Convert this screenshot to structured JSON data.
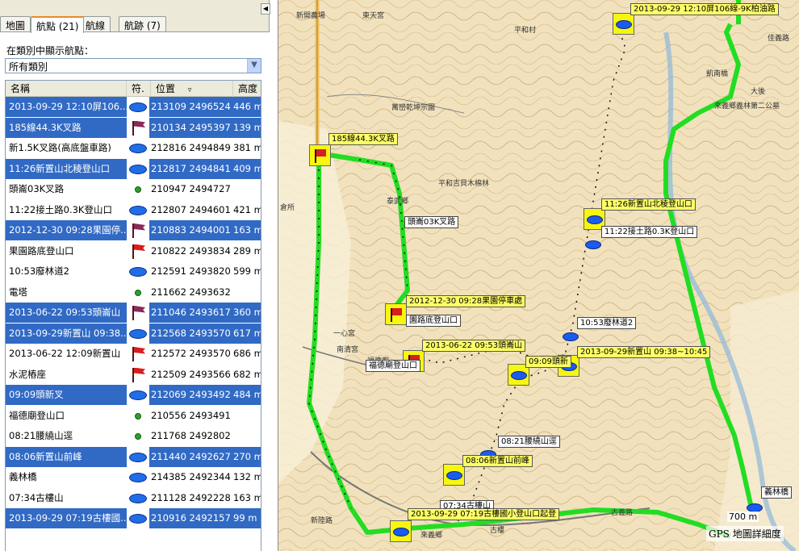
{
  "tabs": [
    {
      "label": "地圖"
    },
    {
      "label": "航點 (21)"
    },
    {
      "label": "航線"
    },
    {
      "label": "航跡 (7)"
    }
  ],
  "filter": {
    "label": "在類別中顯示航點：",
    "selected": "所有類別"
  },
  "table": {
    "headers": {
      "name": "名稱",
      "symbol": "符.",
      "position": "位置",
      "altitude": "高度"
    },
    "rows": [
      {
        "name": "2013-09-29 12:10屏106...",
        "symbol": "ellipse",
        "position": "213109 2496524",
        "altitude": "446 m",
        "selected": true
      },
      {
        "name": "185線44.3K叉路",
        "symbol": "flag-purple",
        "position": "210134 2495397",
        "altitude": "139 m",
        "selected": true
      },
      {
        "name": "新1.5K叉路(高底盤車路)",
        "symbol": "ellipse",
        "position": "212816 2494849",
        "altitude": "381 m",
        "selected": false
      },
      {
        "name": "11:26新置山北稜登山口",
        "symbol": "ellipse",
        "position": "212817 2494841",
        "altitude": "409 m",
        "selected": true
      },
      {
        "name": "頭崙03K叉路",
        "symbol": "dot",
        "position": "210947 2494727",
        "altitude": "",
        "selected": false
      },
      {
        "name": "11:22接土路0.3K登山口",
        "symbol": "ellipse",
        "position": "212807 2494601",
        "altitude": "421 m",
        "selected": false
      },
      {
        "name": "2012-12-30 09:28果園停...",
        "symbol": "flag-purple",
        "position": "210883 2494001",
        "altitude": "163 m",
        "selected": true
      },
      {
        "name": "果園路底登山口",
        "symbol": "flag",
        "position": "210822 2493834",
        "altitude": "289 m",
        "selected": false
      },
      {
        "name": "10:53廢林道2",
        "symbol": "ellipse",
        "position": "212591 2493820",
        "altitude": "599 m",
        "selected": false
      },
      {
        "name": "電塔",
        "symbol": "dot",
        "position": "211662 2493632",
        "altitude": "",
        "selected": false
      },
      {
        "name": "2013-06-22 09:53頭崙山",
        "symbol": "flag-purple",
        "position": "211046 2493617",
        "altitude": "360 m",
        "selected": true
      },
      {
        "name": "2013-09-29新置山 09:38...",
        "symbol": "ellipse",
        "position": "212568 2493570",
        "altitude": "617 m",
        "selected": true
      },
      {
        "name": "2013-06-22 12:09新置山",
        "symbol": "flag",
        "position": "212572 2493570",
        "altitude": "686 m",
        "selected": false
      },
      {
        "name": "水泥樁座",
        "symbol": "flag",
        "position": "212509 2493566",
        "altitude": "682 m",
        "selected": false
      },
      {
        "name": "09:09頭新叉",
        "symbol": "ellipse",
        "position": "212069 2493492",
        "altitude": "484 m",
        "selected": true
      },
      {
        "name": "福德廟登山口",
        "symbol": "dot",
        "position": "210556 2493491",
        "altitude": "",
        "selected": false
      },
      {
        "name": "08:21腰繞山逕",
        "symbol": "dot",
        "position": "211768 2492802",
        "altitude": "",
        "selected": false
      },
      {
        "name": "08:06新置山前峰",
        "symbol": "ellipse",
        "position": "211440 2492627",
        "altitude": "270 m",
        "selected": true
      },
      {
        "name": "義林橋",
        "symbol": "ellipse",
        "position": "214385 2492344",
        "altitude": "132 m",
        "selected": false
      },
      {
        "name": "07:34古樓山",
        "symbol": "ellipse",
        "position": "211128 2492228",
        "altitude": "163 m",
        "selected": false
      },
      {
        "name": "2013-09-29 07:19古樓國...",
        "symbol": "ellipse",
        "position": "210916 2492157",
        "altitude": "99 m",
        "selected": true
      }
    ]
  },
  "map": {
    "labels": [
      {
        "id": "wp-top",
        "text": "2013-09-29 12:10屏106線-9K柏油路",
        "style": "yellow"
      },
      {
        "id": "wp-185",
        "text": "185線44.3K叉路",
        "style": "yellow"
      },
      {
        "id": "wp-toulun",
        "text": "頭崙03K叉路",
        "style": "white"
      },
      {
        "id": "wp-1126",
        "text": "11:26新置山北稜登山口",
        "style": "yellow"
      },
      {
        "id": "wp-1122",
        "text": "11:22接土路0.3K登山口",
        "style": "white"
      },
      {
        "id": "wp-orchard",
        "text": "2012-12-30 09:28果園停車處",
        "style": "yellow"
      },
      {
        "id": "wp-orchard2",
        "text": "園路底登山口",
        "style": "white"
      },
      {
        "id": "wp-1053",
        "text": "10:53廢林道2",
        "style": "white"
      },
      {
        "id": "wp-0953",
        "text": "2013-06-22 09:53頭崙山",
        "style": "yellow"
      },
      {
        "id": "wp-0909",
        "text": "09:09頭新",
        "style": "yellow"
      },
      {
        "id": "wp-0938",
        "text": "2013-09-29新置山 09:38~10:45",
        "style": "yellow"
      },
      {
        "id": "wp-fude",
        "text": "福德廟登山口",
        "style": "white"
      },
      {
        "id": "wp-0821",
        "text": "08:21腰繞山逕",
        "style": "white"
      },
      {
        "id": "wp-0806",
        "text": "08:06新置山前峰",
        "style": "yellow"
      },
      {
        "id": "wp-0734",
        "text": "07:34古樓山",
        "style": "white"
      },
      {
        "id": "wp-0719",
        "text": "2013-09-29 07:19古樓國小登山口起登",
        "style": "yellow"
      },
      {
        "id": "wp-yilin",
        "text": "義林橋",
        "style": "white"
      }
    ],
    "places": [
      "新開農場",
      "東天宮",
      "平和村",
      "萬巒乾坤宗園",
      "平和吉貝木棉林",
      "泰武鄉",
      "倉所",
      "凱南橋",
      "大後",
      "來義鄉義林第二公墓",
      "一心宮",
      "南清宮",
      "福德廟",
      "新陸路",
      "古義路",
      "來義鄉",
      "佳義路",
      "古樓"
    ],
    "scale_distance": "700 m",
    "detail_label": "GPS 地圖詳細度"
  }
}
